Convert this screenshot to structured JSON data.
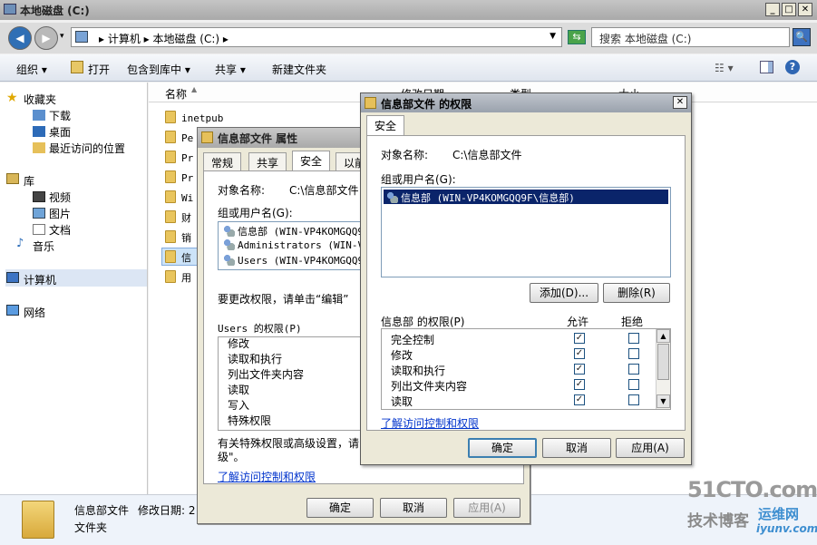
{
  "explorer": {
    "title": "本地磁盘 (C:)",
    "address": {
      "path": "▸ 计算机 ▸ 本地磁盘 (C:) ▸"
    },
    "search_placeholder": "搜索 本地磁盘 (C:)",
    "toolbar": {
      "organize": "组织 ▾",
      "open": "打开",
      "include": "包含到库中 ▾",
      "share": "共享 ▾",
      "new_folder": "新建文件夹"
    },
    "columns": {
      "name": "名称",
      "date": "修改日期",
      "type": "类型",
      "size": "大小"
    },
    "nav": {
      "favorites": "收藏夹",
      "downloads": "下载",
      "desktop": "桌面",
      "recent": "最近访问的位置",
      "libraries": "库",
      "videos": "视频",
      "pictures": "图片",
      "documents": "文档",
      "music": "音乐",
      "computer": "计算机",
      "network": "网络"
    },
    "files": [
      "inetpub",
      "Pe",
      "Pr",
      "Pr",
      "Wi",
      "财",
      "销",
      "信",
      "用"
    ],
    "details": {
      "name": "信息部文件",
      "modified": "修改日期: 2",
      "type": "文件夹"
    }
  },
  "props_dialog": {
    "title": "信息部文件 属性",
    "tabs": [
      "常规",
      "共享",
      "安全",
      "以前"
    ],
    "object_label": "对象名称:",
    "object_value": "C:\\信息部文件",
    "group_label": "组或用户名(G):",
    "users": [
      "信息部 (WIN-VP4KOMGQQ9",
      "Administrators (WIN-VP",
      "Users (WIN-VP4KOMGQQ9F"
    ],
    "edit_hint": "要更改权限，请单击“编辑”",
    "perm_title": "Users 的权限(P)",
    "perms": [
      "修改",
      "读取和执行",
      "列出文件夹内容",
      "读取",
      "写入",
      "特殊权限"
    ],
    "special_hint_1": "有关特殊权限或高级设置，请",
    "special_hint_2": "级\"。",
    "link": "了解访问控制和权限",
    "ok": "确定",
    "cancel": "取消",
    "apply": "应用(A)"
  },
  "perm_dialog": {
    "title": "信息部文件 的权限",
    "tab": "安全",
    "object_label": "对象名称:",
    "object_value": "C:\\信息部文件",
    "group_label": "组或用户名(G):",
    "selected_user": "信息部 (WIN-VP4KOMGQQ9F\\信息部)",
    "add": "添加(D)...",
    "remove": "删除(R)",
    "perm_title": "信息部 的权限(P)",
    "allow": "允许",
    "deny": "拒绝",
    "perms": [
      {
        "name": "完全控制",
        "allow": true,
        "deny": false
      },
      {
        "name": "修改",
        "allow": true,
        "deny": false
      },
      {
        "name": "读取和执行",
        "allow": true,
        "deny": false
      },
      {
        "name": "列出文件夹内容",
        "allow": true,
        "deny": false
      },
      {
        "name": "读取",
        "allow": true,
        "deny": false
      }
    ],
    "link": "了解访问控制和权限",
    "ok": "确定",
    "cancel": "取消",
    "apply": "应用(A)"
  },
  "watermark": {
    "site": "51CTO.com",
    "blog": "技术博客",
    "brand": "运维网",
    "url": "iyunv.com"
  }
}
